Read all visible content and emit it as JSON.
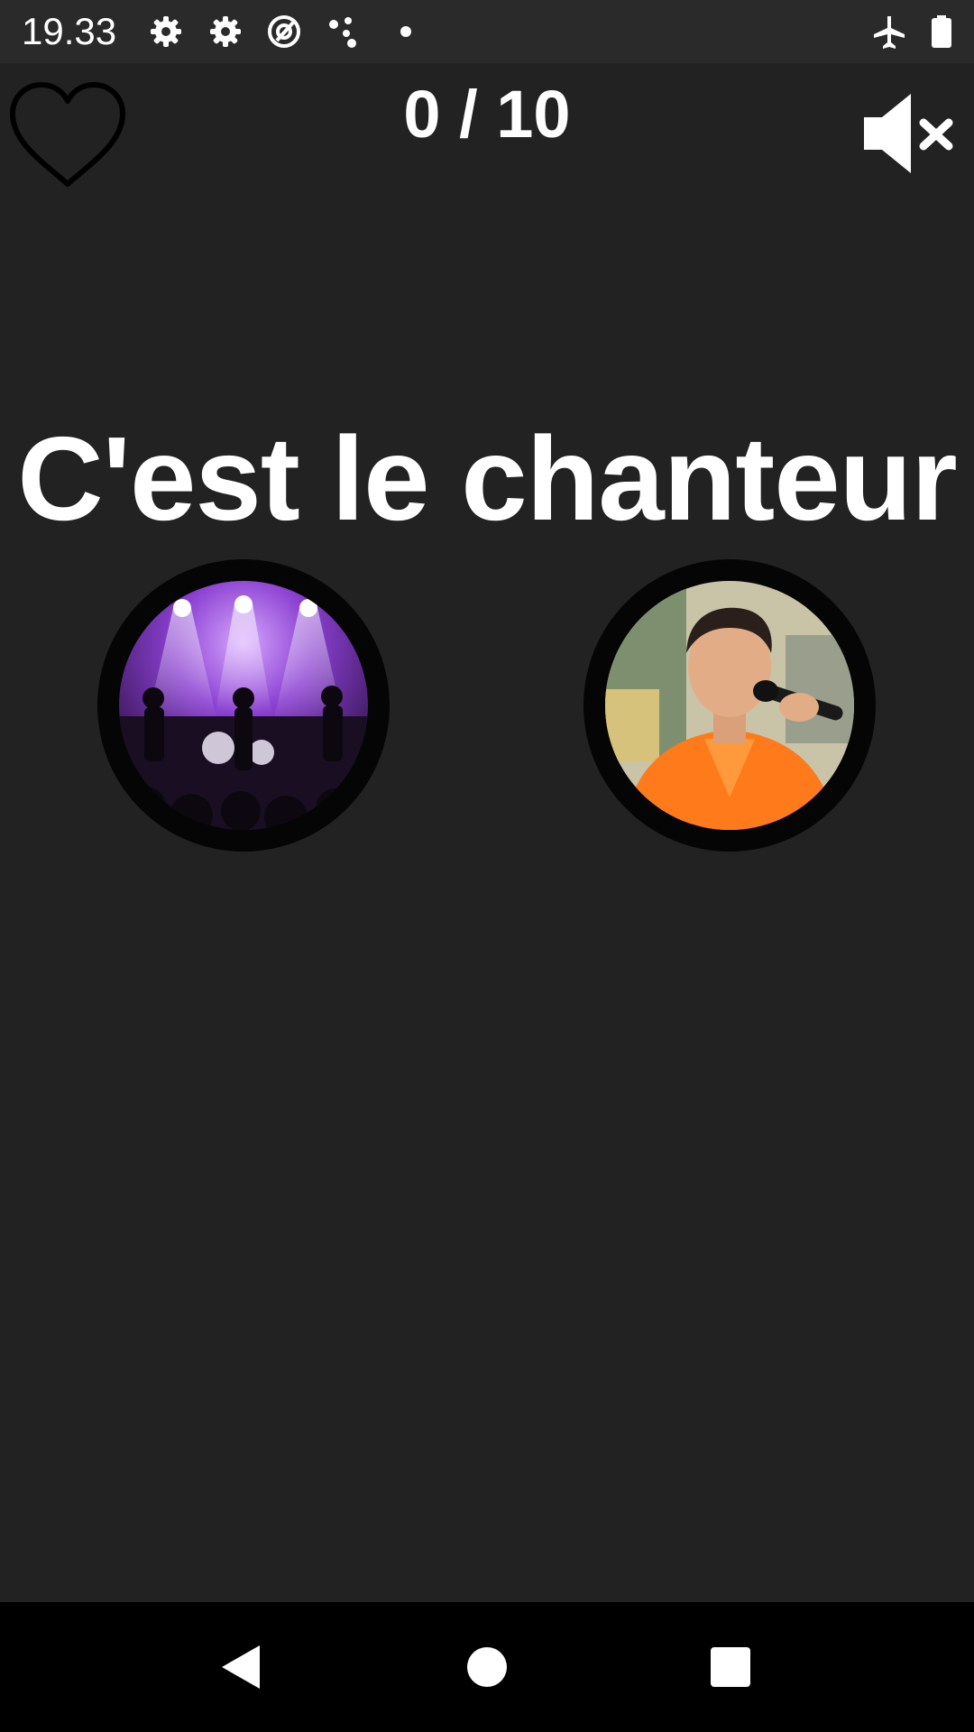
{
  "status_bar": {
    "time": "19.33",
    "left_icons": [
      "gear-icon",
      "gear-icon",
      "at-sign-icon",
      "dots-icon",
      "dot-icon"
    ],
    "right_icons": [
      "airplane-icon",
      "battery-icon"
    ]
  },
  "header": {
    "score": "0 / 10",
    "favorite_icon": "heart-outline-icon",
    "sound_icon": "volume-mute-icon"
  },
  "quiz": {
    "prompt": "C'est le chanteur",
    "choices": [
      {
        "image": "band-concert-photo",
        "accent": "#8a3fd1"
      },
      {
        "image": "singer-orange-suit-photo",
        "accent": "#ff7a1a"
      }
    ]
  },
  "nav_bar": {
    "back_icon": "back-triangle-icon",
    "home_icon": "home-circle-icon",
    "recents_icon": "recents-square-icon"
  },
  "colors": {
    "background": "#222222",
    "status_bar": "#2a2a2a",
    "text": "#ffffff",
    "nav_bar": "#000000"
  }
}
